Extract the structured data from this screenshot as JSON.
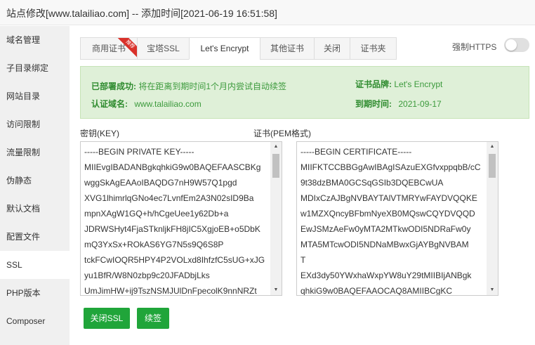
{
  "window": {
    "title": "站点修改[www.talailiao.com] -- 添加时间[2021-06-19 16:51:58]"
  },
  "sidebar": {
    "items": [
      {
        "label": "域名管理"
      },
      {
        "label": "子目录绑定"
      },
      {
        "label": "网站目录"
      },
      {
        "label": "访问限制"
      },
      {
        "label": "流量限制"
      },
      {
        "label": "伪静态"
      },
      {
        "label": "默认文档"
      },
      {
        "label": "配置文件"
      },
      {
        "label": "SSL"
      },
      {
        "label": "PHP版本"
      },
      {
        "label": "Composer"
      }
    ],
    "active": "SSL"
  },
  "tabs": [
    {
      "label": "商用证书",
      "badge": "推荐"
    },
    {
      "label": "宝塔SSL"
    },
    {
      "label": "Let's Encrypt"
    },
    {
      "label": "其他证书"
    },
    {
      "label": "关闭"
    },
    {
      "label": "证书夹"
    }
  ],
  "active_tab": "Let's Encrypt",
  "force_https": {
    "label": "强制HTTPS",
    "enabled": false
  },
  "status": {
    "deploy_label": "已部署成功:",
    "deploy_value": "将在距离到期时间1个月内尝试自动续签",
    "domain_label": "认证域名:",
    "domain_value": "www.talailiao.com",
    "brand_label": "证书品牌:",
    "brand_value": "Let's Encrypt",
    "expire_label": "到期时间:",
    "expire_value": "2021-09-17"
  },
  "key": {
    "label": "密钥(KEY)",
    "value": "-----BEGIN PRIVATE KEY-----\nMIIEvgIBADANBgkqhkiG9w0BAQEFAASCBKg\nwggSkAgEAAoIBAQDG7nH9W57Q1pgd\nXVG1lhimrlqGNo4ec7LvnfEm2A3N02sID9Ba\nmpnXAgW1GQ+h/hCgeUee1y62Db+a\nJDRWSHyt4FjaSTknljkFH8jIC5XgjoEB+o5DbK\nmQ3YxSx+ROkAS6YG7N5s9Q6S8P\ntckFCwIOQR5HPY4P2VOLxd8IhfzfC5sUG+xJG\nyu1BfR/W8N0zbp9c20JFADbjLks\nUmJimHW+ij9TszNSMJUlDnFpecolK9nnNRZt"
  },
  "cert": {
    "label": "证书(PEM格式)",
    "value": "-----BEGIN CERTIFICATE-----\nMIIFKTCCBBGgAwIBAgISAzuEXGfvxppqbB/cC\n9t38dzBMA0GCSqGSIb3DQEBCwUA\nMDIxCzAJBgNVBAYTAlVTMRYwFAYDVQQKE\nw1MZXQncyBFbmNyeXB0MQswCQYDVQQD\nEwJSMzAeFw0yMTA2MTkwODI5NDRaFw0y\nMTA5MTcwODI5NDNaMBwxGjAYBgNVBAM\nT\nEXd3dy50YWxhaWxpYW8uY29tMIIBIjANBgk\nqhkiG9w0BAQEFAAOCAQ8AMIIBCgKC"
  },
  "buttons": {
    "close_ssl": "关闭SSL",
    "renew": "续签"
  },
  "colors": {
    "accent": "#20a53a",
    "success_bg": "#dff0d8",
    "success_text": "#3c9a3c",
    "ribbon": "#d9312a"
  }
}
